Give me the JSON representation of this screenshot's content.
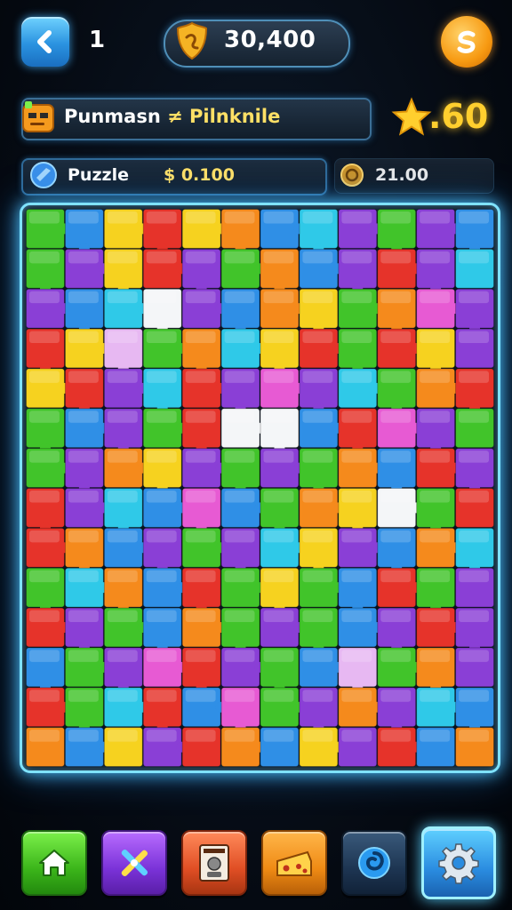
{
  "header": {
    "level": "1",
    "coins": "30,400",
    "back_icon": "chevron-left-icon",
    "coin_icon": "shield-coin-icon",
    "currency_icon": "orange-coin-icon"
  },
  "title_bar": {
    "title_part1": "Punmasn",
    "title_part2": "≠ Pilnknile",
    "star_score": ".60",
    "star_icon": "star-icon"
  },
  "info_bar": {
    "puzzle_label": "Puzzle",
    "puzzle_score": "$ 0.100",
    "coins_value": "21.00",
    "gem_icon": "gem-icon",
    "coin_icon": "coin-icon"
  },
  "board": {
    "columns": 12,
    "rows": 14,
    "palette": {
      "G": "#41c42a",
      "B": "#2f8fe6",
      "Y": "#f6d21f",
      "R": "#e6332a",
      "P": "#8a3fd6",
      "O": "#f58a1c",
      "C": "#2fc9e8",
      "K": "#e75ad3",
      "L": "#e7b8f2",
      "W": "#f4f6f8"
    },
    "pieces": [
      "GBYRYOBCPGPB",
      "GPYRPGOBPRPC",
      "PBCWPBOYGOKP",
      "RYLGOCYRGRYP",
      "YRPCRPKPCGOR",
      "GBPGRWWBRKPG",
      "GPOYPGPGOBRP",
      "RPCBKBGOYWGR",
      "ROBPGPCYPBOC",
      "GCOBRGYGBRGP",
      "RPGBOGPGBPRP",
      "BGPKRPGBLGOP",
      "RGCRBKGPOPCB",
      "OBYPROBYPRBO"
    ]
  },
  "bottom_nav": [
    {
      "name": "home",
      "icon": "home-icon"
    },
    {
      "name": "tools",
      "icon": "crossed-tools-icon"
    },
    {
      "name": "card",
      "icon": "portrait-card-icon"
    },
    {
      "name": "cheese",
      "icon": "cheese-icon"
    },
    {
      "name": "swirl",
      "icon": "swirl-icon"
    },
    {
      "name": "settings",
      "icon": "gear-icon"
    }
  ]
}
